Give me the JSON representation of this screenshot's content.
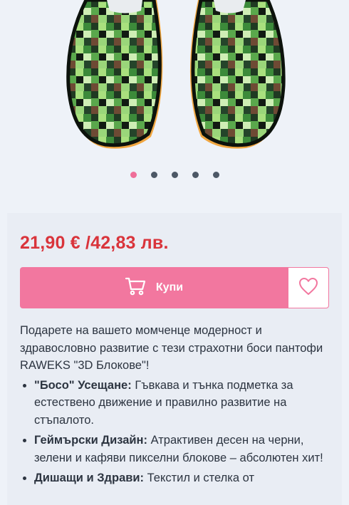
{
  "product": {
    "image_alt": "RAWEKS 3D Блокове pixel-block slippers",
    "price": "21,90 € /42,83 лв.",
    "buy_label": "Купи",
    "gallery": {
      "slides": 5,
      "active_index": 0
    },
    "intro": "Подарете на вашето момченце модерност и здравословно развитие с тези страхотни боси пантофи RAWEKS \"3D Блокове\"!",
    "features": [
      {
        "title": "\"Босо\" Усещане:",
        "text": " Гъвкава и тънка подметка за естествено движение и правилно развитие на стъпалото."
      },
      {
        "title": "Геймърски Дизайн:",
        "text": " Атрактивен десен на черни, зелени и кафяви пикселни блокове – абсолютен хит!"
      },
      {
        "title": "Дишащи и Здрави:",
        "text": " Текстил и стелка от"
      }
    ]
  },
  "colors": {
    "accent": "#f2779f",
    "price": "#d9343b",
    "dot_active": "#ef6e99",
    "dot_inactive": "#4c5866"
  },
  "icons": {
    "buy": "cart-icon",
    "wishlist": "heart-icon"
  }
}
